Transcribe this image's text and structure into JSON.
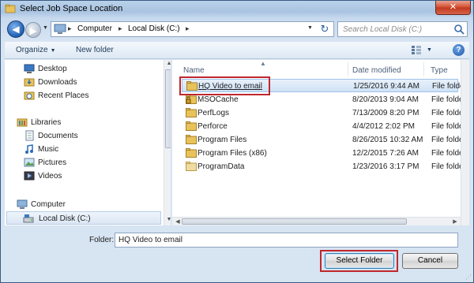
{
  "window": {
    "title": "Select Job Space Location",
    "close_label": "✕"
  },
  "address": {
    "segments": [
      "Computer",
      "Local Disk (C:)"
    ],
    "separator": "▸",
    "refresh_glyph": "↻"
  },
  "search": {
    "placeholder": "Search Local Disk (C:)"
  },
  "toolbar": {
    "organize_label": "Organize",
    "new_folder_label": "New folder",
    "help_label": "?"
  },
  "sidebar": {
    "items": [
      {
        "label": "Desktop",
        "icon": "desktop-icon"
      },
      {
        "label": "Downloads",
        "icon": "downloads-icon"
      },
      {
        "label": "Recent Places",
        "icon": "recent-places-icon"
      },
      {
        "label": "Libraries",
        "icon": "libraries-icon"
      },
      {
        "label": "Documents",
        "icon": "documents-icon"
      },
      {
        "label": "Music",
        "icon": "music-icon"
      },
      {
        "label": "Pictures",
        "icon": "pictures-icon"
      },
      {
        "label": "Videos",
        "icon": "videos-icon"
      },
      {
        "label": "Computer",
        "icon": "computer-icon"
      },
      {
        "label": "Local Disk (C:)",
        "icon": "drive-icon",
        "selected": true
      }
    ]
  },
  "files": {
    "columns": {
      "name": "Name",
      "date": "Date modified",
      "type": "Type"
    },
    "rows": [
      {
        "name": "HQ Video to email",
        "date": "1/25/2016 9:44 AM",
        "type": "File folder",
        "selected": true
      },
      {
        "name": "MSOCache",
        "date": "8/20/2013 9:04 AM",
        "type": "File folder",
        "locked": true
      },
      {
        "name": "PerfLogs",
        "date": "7/13/2009 8:20 PM",
        "type": "File folder"
      },
      {
        "name": "Perforce",
        "date": "4/4/2012 2:02 PM",
        "type": "File folder"
      },
      {
        "name": "Program Files",
        "date": "8/26/2015 10:32 AM",
        "type": "File folder"
      },
      {
        "name": "Program Files (x86)",
        "date": "12/2/2015 7:26 AM",
        "type": "File folder"
      },
      {
        "name": "ProgramData",
        "date": "1/23/2016 3:17 PM",
        "type": "File folder"
      }
    ]
  },
  "footer": {
    "folder_label": "Folder:",
    "folder_value": "HQ Video to email",
    "select_label": "Select Folder",
    "cancel_label": "Cancel"
  },
  "colors": {
    "highlight_box": "#c0272d",
    "selection": "#cfe2f6",
    "folder": "#e8c25a"
  }
}
